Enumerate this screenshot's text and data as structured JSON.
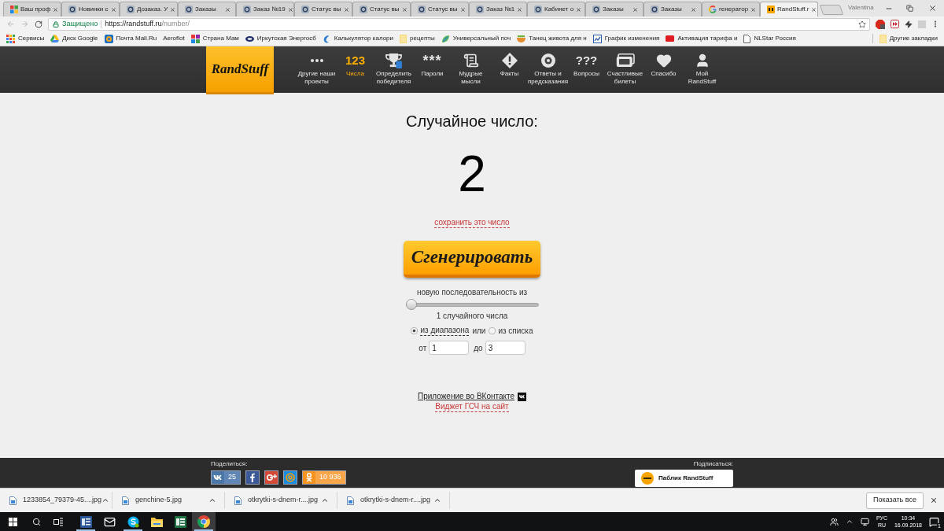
{
  "browser": {
    "tabs": [
      {
        "kind": "grid",
        "title": "Ваш проф",
        "selected": false
      },
      {
        "kind": "site",
        "title": "Новинки с",
        "selected": false
      },
      {
        "kind": "site",
        "title": "Дозаказ. У",
        "selected": false
      },
      {
        "kind": "site",
        "title": "Заказы",
        "selected": false
      },
      {
        "kind": "site",
        "title": "Заказ №19",
        "selected": false
      },
      {
        "kind": "site",
        "title": "Статус вы",
        "selected": false
      },
      {
        "kind": "site",
        "title": "Статус вы",
        "selected": false
      },
      {
        "kind": "site",
        "title": "Статус вы",
        "selected": false
      },
      {
        "kind": "site",
        "title": "Заказ №1",
        "selected": false
      },
      {
        "kind": "site",
        "title": "Кабинет о",
        "selected": false
      },
      {
        "kind": "site",
        "title": "Заказы",
        "selected": false
      },
      {
        "kind": "site",
        "title": "Заказы",
        "selected": false
      },
      {
        "kind": "google",
        "title": "генератор",
        "selected": false
      },
      {
        "kind": "randstuff",
        "title": "RandStuff.r",
        "selected": true
      }
    ],
    "profile": "Valentina",
    "security": "Защищено",
    "url_host": "https://randstuff.ru",
    "url_path": "/number/",
    "bookmarks": [
      {
        "kind": "apps",
        "label": "Сервисы"
      },
      {
        "kind": "drive",
        "label": "Диск Google"
      },
      {
        "kind": "mail",
        "label": "Почта Mail.Ru"
      },
      {
        "label": "Aeroflot"
      },
      {
        "kind": "grid",
        "label": "Страна Мам"
      },
      {
        "kind": "oval",
        "label": "Иркутская Энергосб"
      },
      {
        "kind": "swirl",
        "label": "Калькулятор калори"
      },
      {
        "kind": "folder",
        "label": "рецепты"
      },
      {
        "kind": "leaf",
        "label": "Универсальный поч"
      },
      {
        "kind": "bowl",
        "label": "Танец живота для н"
      },
      {
        "kind": "chart",
        "label": "График изменения"
      },
      {
        "kind": "card",
        "label": "Активация тарифа и"
      },
      {
        "kind": "page",
        "label": "NLStar Россия"
      }
    ],
    "other_bookmarks": "Другие закладки"
  },
  "site": {
    "logo": "RandStuff",
    "nav": [
      {
        "kind": "dots",
        "label": "Другие наши проекты",
        "selected": false
      },
      {
        "kind": "digits",
        "icon_text": "123",
        "label": "Числа",
        "selected": true
      },
      {
        "kind": "trophy",
        "label": "Определить победителя",
        "selected": false
      },
      {
        "kind": "stars",
        "icon_text": "***",
        "label": "Пароли",
        "selected": false
      },
      {
        "kind": "scroll",
        "label": "Мудрые мысли",
        "selected": false
      },
      {
        "kind": "warning",
        "label": "Факты",
        "selected": false
      },
      {
        "kind": "ball",
        "label": "Ответы и предсказания",
        "selected": false
      },
      {
        "kind": "questions",
        "icon_text": "???",
        "label": "Вопросы",
        "selected": false
      },
      {
        "kind": "tickets",
        "label": "Счастливые билеты",
        "selected": false
      },
      {
        "kind": "heart",
        "label": "Спасибо",
        "selected": false
      },
      {
        "kind": "user",
        "label": "Мой RandStuff",
        "selected": false
      }
    ]
  },
  "generator": {
    "title": "Случайное число:",
    "result": "2",
    "save_link": "сохранить это число",
    "button": "Сгенерировать",
    "sequence_label": "новую последовательность из",
    "count_slider": {
      "level": 0
    },
    "count_label": "1 случайного числа",
    "modes": [
      {
        "label": "из диапазона",
        "selected": true
      },
      {
        "label": "из списка",
        "selected": false
      }
    ],
    "modes_joiner": "или",
    "from_label": "от",
    "from_value": "1",
    "to_label": "до",
    "to_value": "3"
  },
  "links": {
    "vk_app": "Приложение во ВКонтакте",
    "widget": "Виджет ГСЧ на сайт"
  },
  "footer": {
    "share_label": "Поделиться:",
    "share": [
      {
        "kind": "vk",
        "count": "25"
      },
      {
        "kind": "facebook"
      },
      {
        "kind": "gplus"
      },
      {
        "kind": "mail"
      },
      {
        "kind": "ok",
        "count": "10 936"
      }
    ],
    "subscribe_label": "Подписаться:",
    "subscribe_card": "Паблик RandStuff"
  },
  "downloads": {
    "files": [
      "1233854_79379-45....jpg",
      "genchine-5.jpg",
      "otkrytki-s-dnem-r....jpg",
      "otkrytki-s-dnem-r....jpg"
    ],
    "show_all": "Показать все"
  },
  "taskbar": {
    "apps": [
      {
        "kind": "word",
        "selected": false,
        "running": true
      },
      {
        "kind": "mail",
        "selected": false,
        "running": false
      },
      {
        "kind": "skype",
        "selected": false,
        "running": true
      },
      {
        "kind": "explorer",
        "selected": false,
        "running": false
      },
      {
        "kind": "excel",
        "selected": false,
        "running": false
      },
      {
        "kind": "chrome",
        "selected": true,
        "running": true
      }
    ],
    "language": "РУС",
    "region": "RU",
    "time": "10:34",
    "date": "16.09.2018",
    "notifications": "1"
  }
}
